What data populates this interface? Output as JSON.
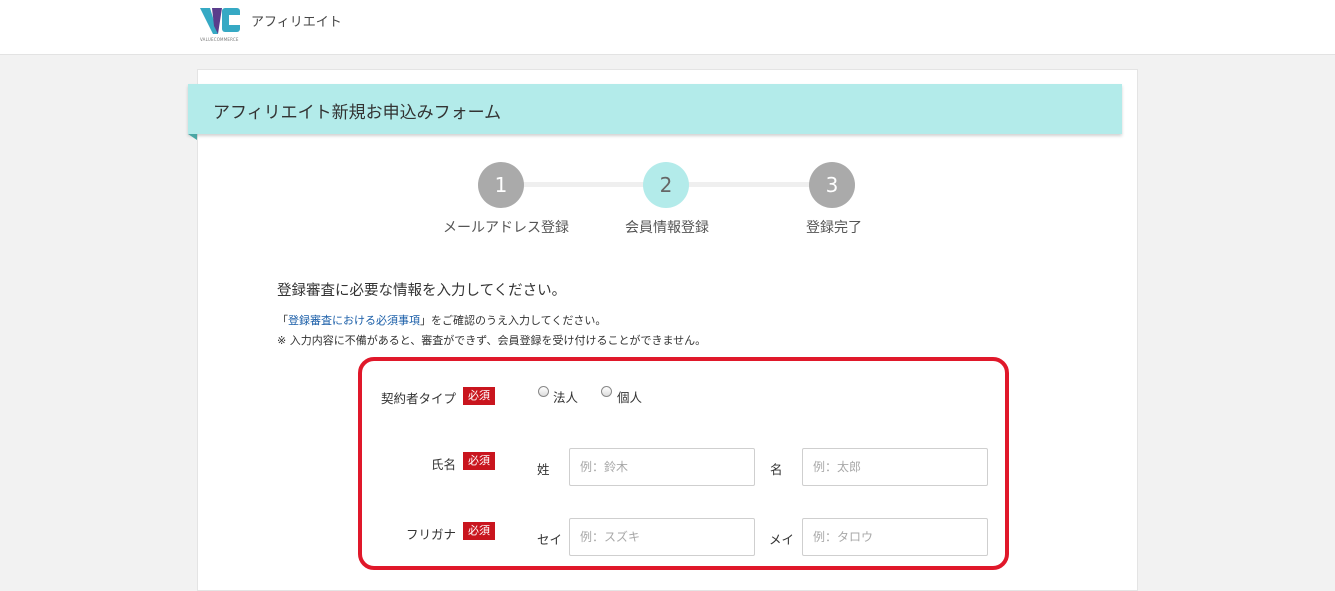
{
  "header": {
    "logo_subtext": "VALUECOMMERCE",
    "app_title": "アフィリエイト",
    "brand_colors": {
      "teal": "#36a9c4",
      "purple": "#5a3c8c"
    }
  },
  "form": {
    "title": "アフィリエイト新規お申込みフォーム",
    "steps": [
      {
        "number": "1",
        "label": "メールアドレス登録",
        "state": "done",
        "color": "#aaaaaa"
      },
      {
        "number": "2",
        "label": "会員情報登録",
        "state": "current",
        "color": "#b3ebea"
      },
      {
        "number": "3",
        "label": "登録完了",
        "state": "upcoming",
        "color": "#aaaaaa"
      }
    ],
    "intro": "登録審査に必要な情報を入力してください。",
    "note_prefix": "「",
    "note_link": "登録審査における必須事項",
    "note_suffix": "」をご確認のうえ入力してください。",
    "note_warning": "※ 入力内容に不備があると、審査ができず、会員登録を受け付けることができません。",
    "required_badge": "必須",
    "fields": {
      "contract_type": {
        "label": "契約者タイプ",
        "options": [
          "法人",
          "個人"
        ]
      },
      "name": {
        "label": "氏名",
        "last_label": "姓",
        "last_placeholder": "例：鈴木",
        "first_label": "名",
        "first_placeholder": "例：太郎"
      },
      "furigana": {
        "label": "フリガナ",
        "last_label": "セイ",
        "last_placeholder": "例：スズキ",
        "first_label": "メイ",
        "first_placeholder": "例：タロウ"
      }
    }
  },
  "highlight_color": "#e0182a"
}
